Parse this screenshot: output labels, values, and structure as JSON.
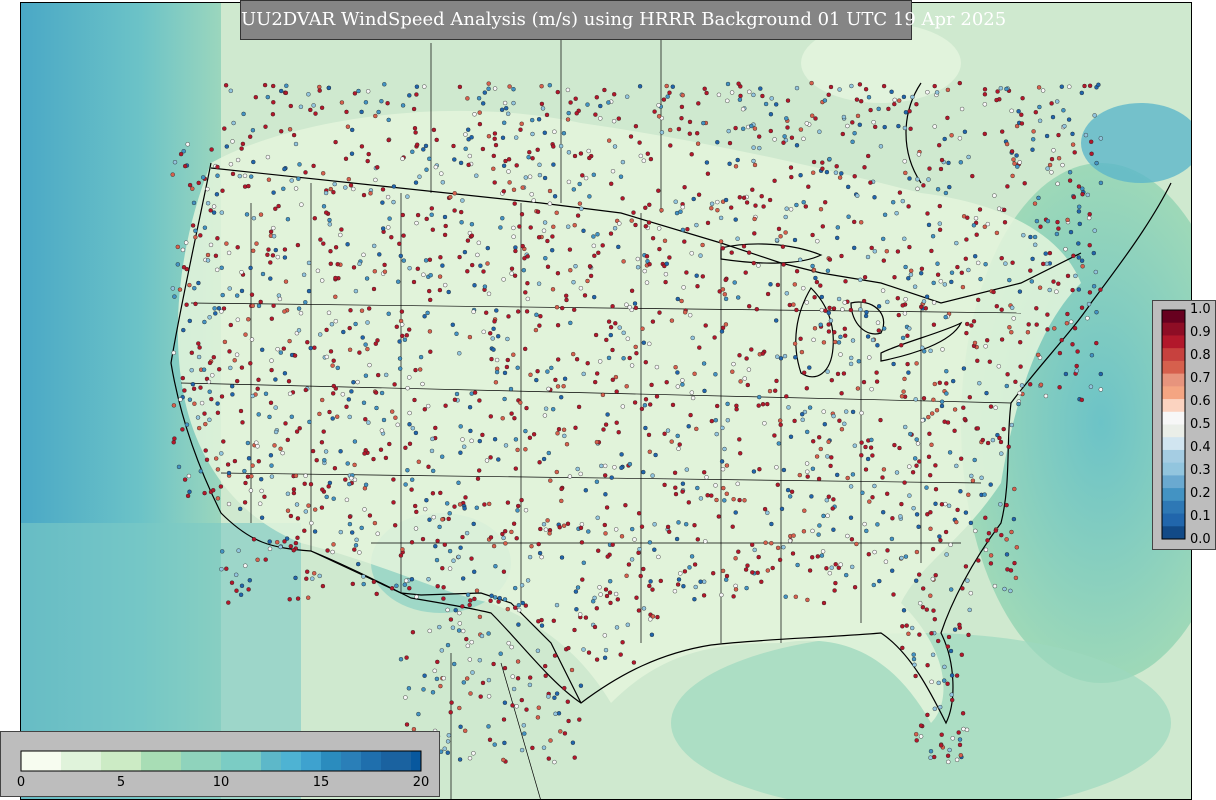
{
  "title": "UU2DVAR WindSpeed Analysis (m/s) using HRRR Background 01 UTC 19 Apr 2025",
  "map_description_icons": [
    "station-dot"
  ],
  "colors": {
    "ocean_base": "#5db8c9",
    "land_base": "#d9f0d3",
    "dot_high": "#b2182b",
    "dot_mid": "#f7f7f7",
    "dot_low": "#2166ac"
  },
  "right_colorbar": {
    "ticks": [
      "1.0",
      "0.9",
      "0.8",
      "0.7",
      "0.6",
      "0.5",
      "0.4",
      "0.3",
      "0.2",
      "0.1",
      "0.0"
    ],
    "colors": [
      "#67001f",
      "#8e0d25",
      "#b2182b",
      "#c7413e",
      "#d6604d",
      "#e7947d",
      "#f4a582",
      "#fbd3c0",
      "#f7f7f7",
      "#eaeee8",
      "#d1e5f0",
      "#a5cde3",
      "#92c5de",
      "#6aa9d0",
      "#4393c3",
      "#2e78b5",
      "#2166ac",
      "#124a87"
    ]
  },
  "bottom_colorbar": {
    "ticks": [
      "0",
      "5",
      "10",
      "15",
      "20"
    ],
    "min": 0,
    "max": 20,
    "bands": [
      {
        "from": 0,
        "to": 2,
        "color": "#f7fcf0"
      },
      {
        "from": 2,
        "to": 4,
        "color": "#e0f3db"
      },
      {
        "from": 4,
        "to": 6,
        "color": "#ccebc5"
      },
      {
        "from": 6,
        "to": 8,
        "color": "#a8ddb5"
      },
      {
        "from": 8,
        "to": 10,
        "color": "#8fd3bc"
      },
      {
        "from": 10,
        "to": 12,
        "color": "#7bccc4"
      },
      {
        "from": 12,
        "to": 13,
        "color": "#5db8c9"
      },
      {
        "from": 13,
        "to": 14,
        "color": "#4eb3d3"
      },
      {
        "from": 14,
        "to": 15,
        "color": "#3ea2cf"
      },
      {
        "from": 15,
        "to": 16,
        "color": "#2b8cbe"
      },
      {
        "from": 16,
        "to": 17,
        "color": "#2a7fb8"
      },
      {
        "from": 17,
        "to": 18,
        "color": "#1f6fad"
      },
      {
        "from": 18,
        "to": 19.5,
        "color": "#1a62a0"
      },
      {
        "from": 19.5,
        "to": 20,
        "color": "#08589e"
      }
    ]
  }
}
